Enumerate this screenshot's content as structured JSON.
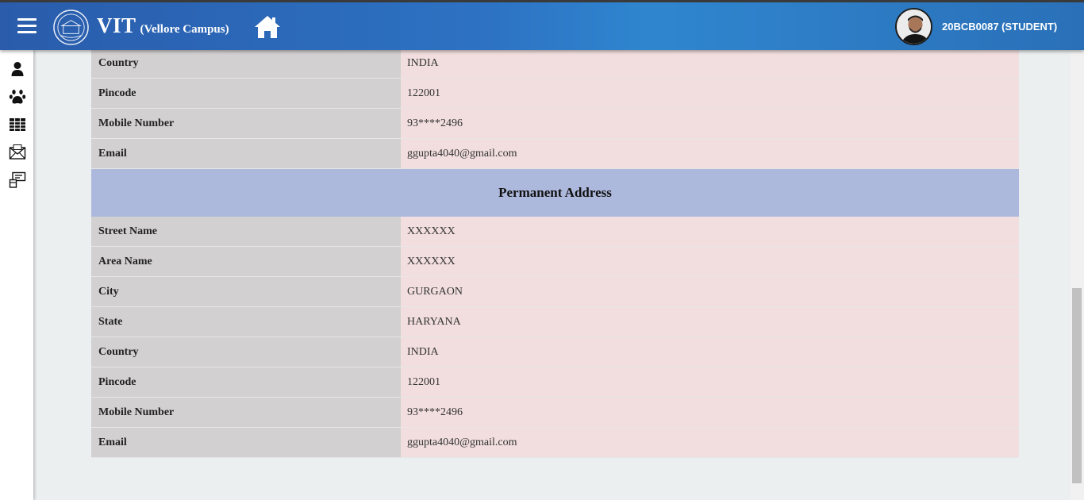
{
  "header": {
    "brand": "VIT",
    "campus": "(Vellore Campus)",
    "user_id": "20BCB0087 (STUDENT)"
  },
  "sidebar": {
    "icons": [
      "user-icon",
      "paw-icon",
      "table-icon",
      "mail-icon",
      "id-card-icon"
    ]
  },
  "current_rows": [
    {
      "label": "Country",
      "value": "INDIA"
    },
    {
      "label": "Pincode",
      "value": "122001"
    },
    {
      "label": "Mobile Number",
      "value": "93****2496"
    },
    {
      "label": "Email",
      "value": "ggupta4040@gmail.com"
    }
  ],
  "permanent": {
    "title": "Permanent Address",
    "rows": [
      {
        "label": "Street Name",
        "value": "XXXXXX"
      },
      {
        "label": "Area Name",
        "value": "XXXXXX"
      },
      {
        "label": "City",
        "value": "GURGAON"
      },
      {
        "label": "State",
        "value": "HARYANA"
      },
      {
        "label": "Country",
        "value": "INDIA"
      },
      {
        "label": "Pincode",
        "value": "122001"
      },
      {
        "label": "Mobile Number",
        "value": "93****2496"
      },
      {
        "label": "Email",
        "value": "ggupta4040@gmail.com"
      }
    ]
  },
  "colors": {
    "header_start": "#2a5cab",
    "header_end": "#2f86cf",
    "label_bg": "#d2d0d0",
    "value_bg": "#f2dede",
    "section_bg": "#adb9dc"
  }
}
